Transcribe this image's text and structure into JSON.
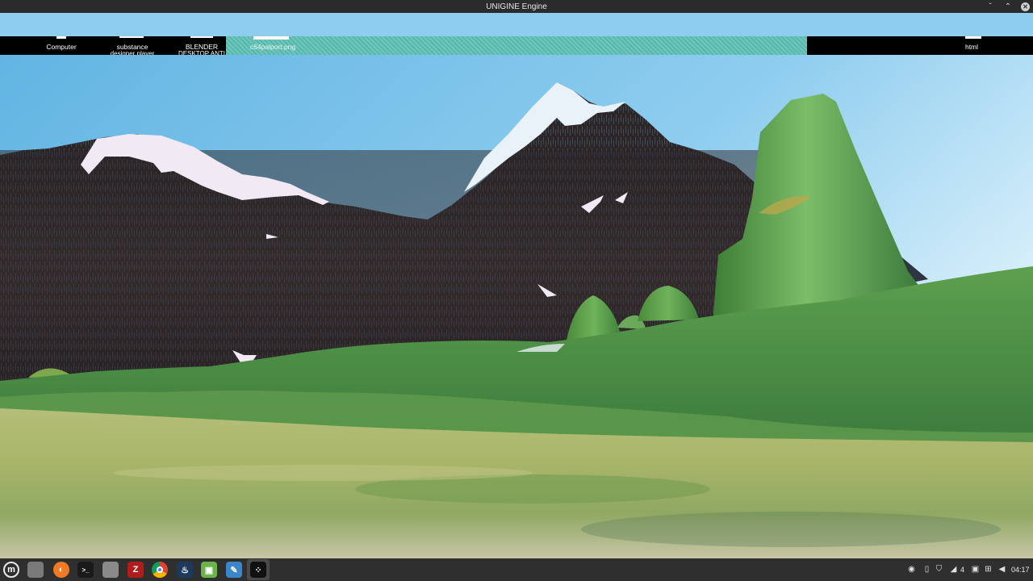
{
  "window": {
    "title": "UNIGINE Engine",
    "minimize_glyph": "ˇ",
    "maximize_glyph": "⌃",
    "close_glyph": "✕"
  },
  "desktop": {
    "icons": [
      {
        "label": "Computer",
        "sublabel": ""
      },
      {
        "label": "substance",
        "sublabel": "designer player"
      },
      {
        "label": "BLENDER",
        "sublabel": "DESKTOP ANTI"
      },
      {
        "label": "c64palport.png",
        "sublabel": ""
      },
      {
        "label": "html",
        "sublabel": ""
      }
    ]
  },
  "scene": {
    "sky_top": "#6bbde8",
    "sky_bottom": "#d6eefa",
    "rock_color": "#2c2628",
    "snow_color": "#f0e8f2",
    "grass_color": "#5c9e4a",
    "ground_color": "#a4b36a"
  },
  "taskbar": {
    "apps": [
      {
        "name": "mint-menu-icon",
        "glyph": "m",
        "color": "#2f2f2f"
      },
      {
        "name": "show-desktop-icon",
        "glyph": "",
        "color": "#7a7a7a"
      },
      {
        "name": "firefox-icon",
        "glyph": "◐",
        "color": "#f07a25"
      },
      {
        "name": "terminal-icon",
        "glyph": ">_",
        "color": "#1a1a1a"
      },
      {
        "name": "files-icon",
        "glyph": "",
        "color": "#8a8a8a"
      },
      {
        "name": "filezilla-icon",
        "glyph": "Z",
        "color": "#b01c1c"
      },
      {
        "name": "chrome-icon",
        "glyph": "●",
        "color": "#e8e8e8"
      },
      {
        "name": "steam-icon",
        "glyph": "♨",
        "color": "#1b3a5c"
      },
      {
        "name": "software-manager-icon",
        "glyph": "▣",
        "color": "#6bb34a"
      },
      {
        "name": "text-editor-icon",
        "glyph": "✎",
        "color": "#3a86c8"
      },
      {
        "name": "unigine-icon",
        "glyph": "⁘",
        "color": "#111111"
      }
    ],
    "tray": {
      "workspace_count": "4",
      "clock": "04:17"
    }
  }
}
